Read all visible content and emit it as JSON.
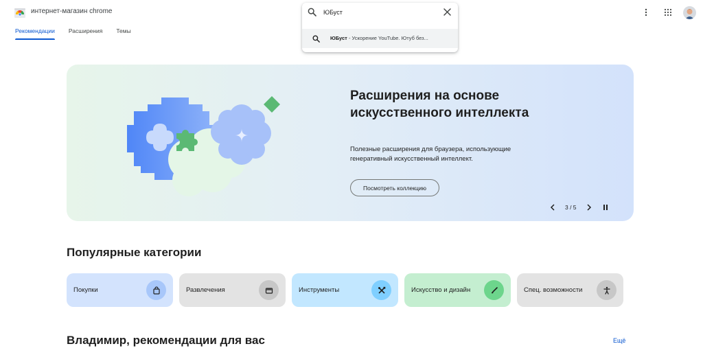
{
  "header": {
    "store_title": "интернет-магазин chrome",
    "tabs": [
      {
        "label": "Рекомендации",
        "active": true
      },
      {
        "label": "Расширения",
        "active": false
      },
      {
        "label": "Темы",
        "active": false
      }
    ],
    "icons": [
      "more-vert-icon",
      "apps-grid-icon",
      "avatar"
    ]
  },
  "search": {
    "value": "ЮБуст",
    "suggestion_bold": "ЮБуст",
    "suggestion_rest": " - Ускорение YouTube. Ютуб без..."
  },
  "hero": {
    "title": "Расширения на основе искусственного интеллекта",
    "description": "Полезные расширения для браузера, использующие генеративный искусственный интеллект.",
    "button_label": "Посмотреть коллекцию",
    "counter": "3 / 5"
  },
  "categories_section": {
    "title": "Популярные категории",
    "items": [
      {
        "label": "Покупки",
        "icon": "shopping-bag-icon",
        "bg": "#d3e3fd",
        "icon_bg": "#a8c7fa"
      },
      {
        "label": "Развлечения",
        "icon": "movie-icon",
        "bg": "#e3e3e3",
        "icon_bg": "#c7c7c7"
      },
      {
        "label": "Инструменты",
        "icon": "tools-icon",
        "bg": "#c2e7ff",
        "icon_bg": "#7fcfff"
      },
      {
        "label": "Искусство и дизайн",
        "icon": "brush-icon",
        "bg": "#c4eed0",
        "icon_bg": "#6dd58c"
      },
      {
        "label": "Спец. возможности",
        "icon": "accessibility-icon",
        "bg": "#e3e3e3",
        "icon_bg": "#c7c7c7"
      }
    ]
  },
  "recommendations": {
    "title": "Владимир, рекомендации для вас",
    "more_label": "Ещё"
  },
  "colors": {
    "accent": "#0b57d0"
  }
}
